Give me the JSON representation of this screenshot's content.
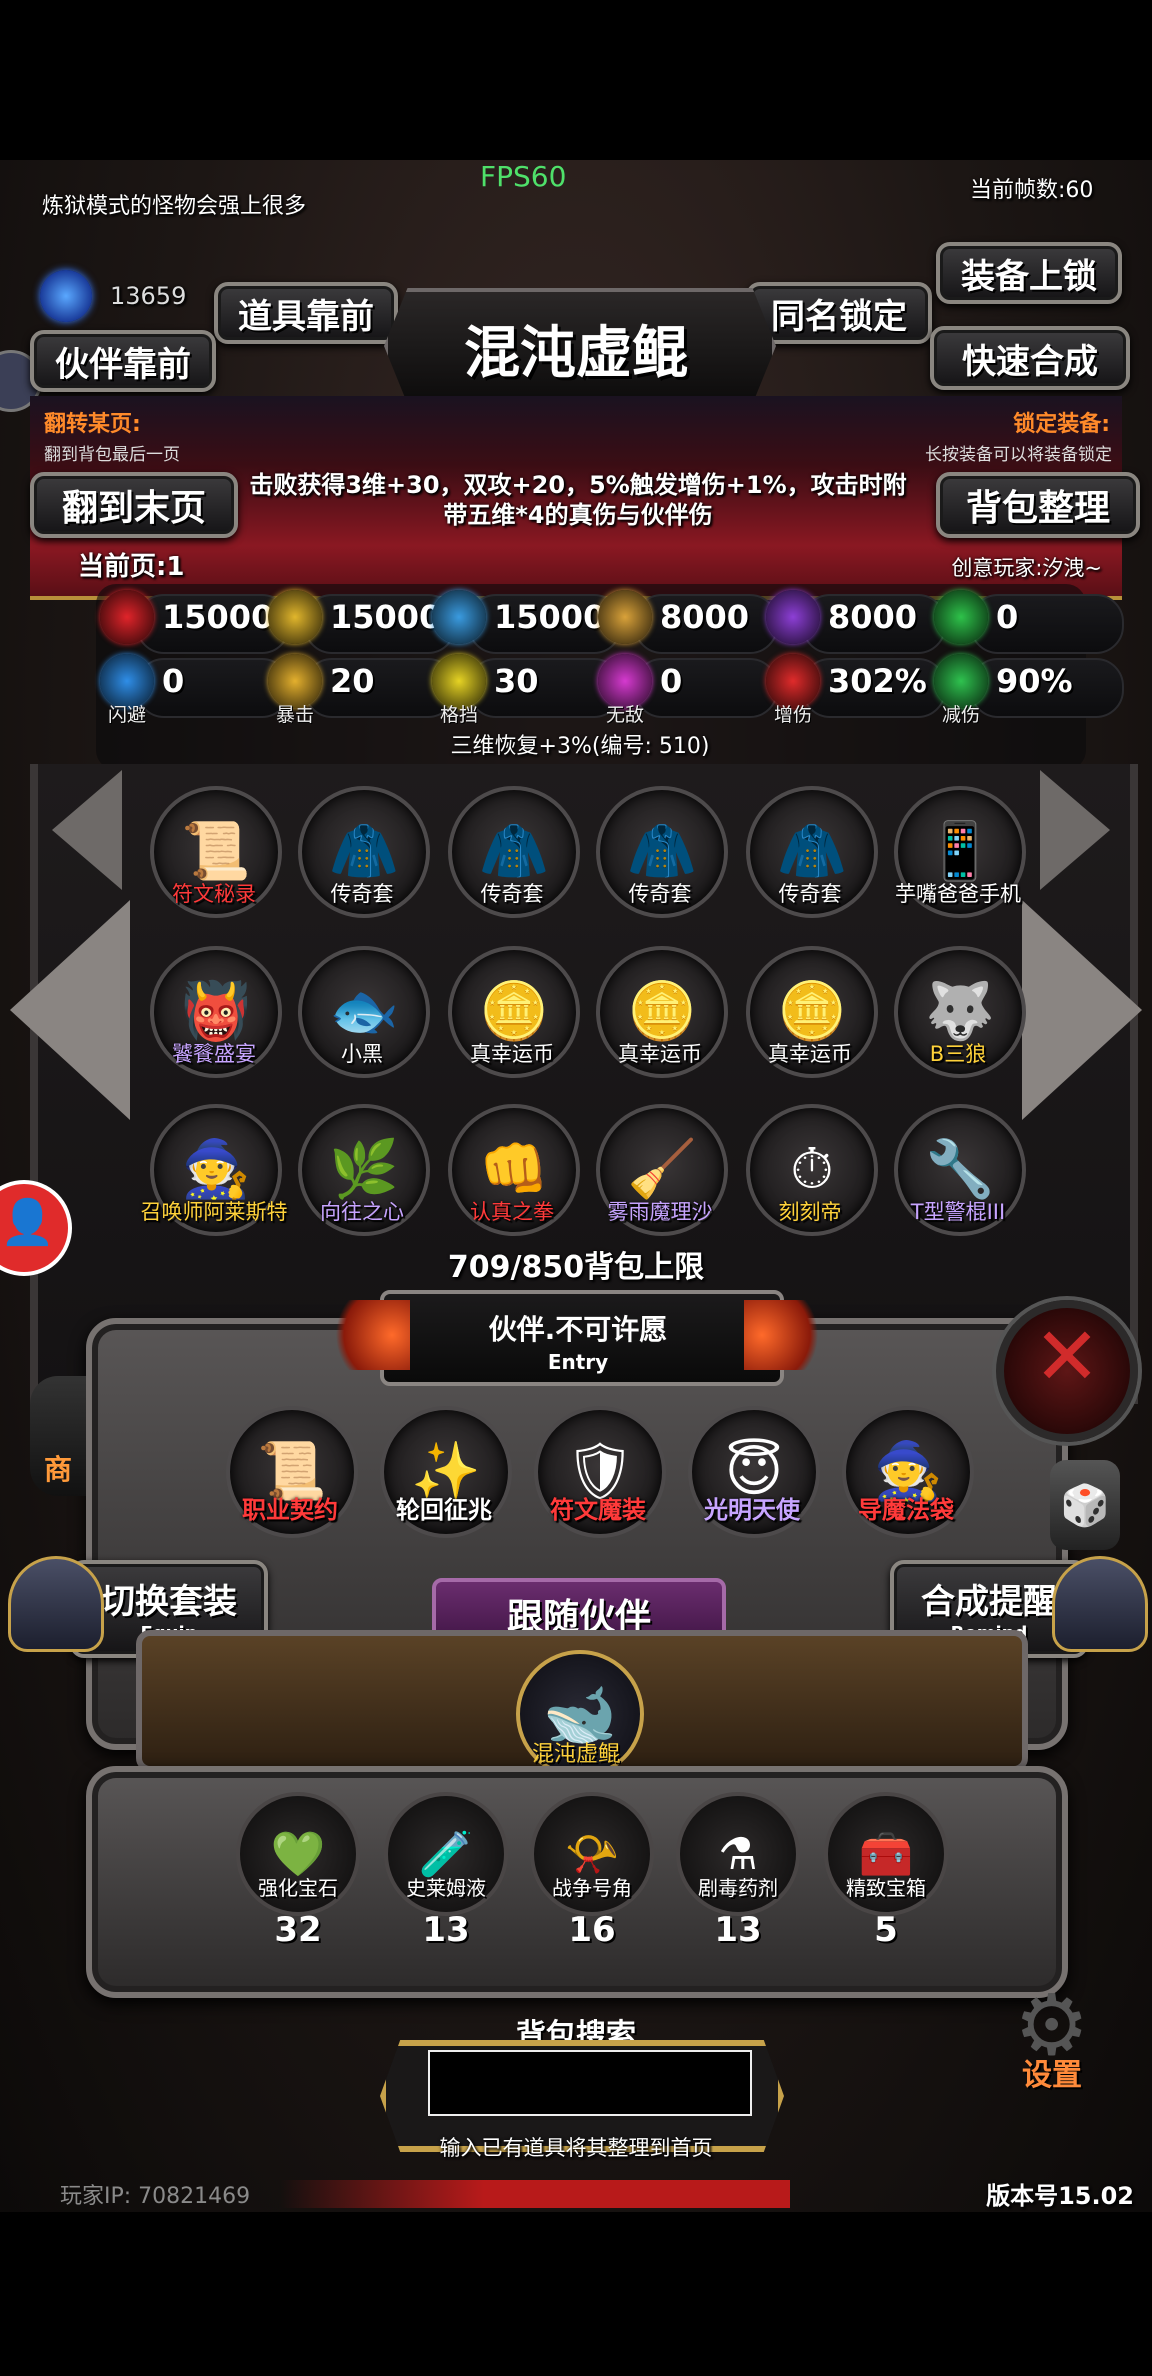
{
  "hud": {
    "fps": "FPS60",
    "hint": "炼狱模式的怪物会强上很多",
    "frame_counter": "当前帧数:60",
    "gems": "13659",
    "player_ip": "玩家IP:  70821469",
    "version": "版本号15.02"
  },
  "top_buttons": {
    "items_front": "道具靠前",
    "partner_front": "伙伴靠前",
    "same_name_lock": "同名锁定",
    "equip_lock": "装备上锁",
    "quick_synth": "快速合成",
    "jump_last": "翻到末页",
    "bag_sort": "背包整理"
  },
  "item_detail": {
    "title": "混沌虚鲲",
    "flip_title": "翻转某页:",
    "flip_sub": "翻到背包最后一页",
    "lock_title": "锁定装备:",
    "lock_sub": "长按装备可以将装备锁定",
    "description": "击败获得3维+30，双攻+20，5%触发增伤+1%，攻击时附带五维*4的真伤与伙伴伤",
    "current_page": "当前页:1",
    "creator": "创意玩家:汐洩~",
    "regen": "三维恢复+3%(编号: 510)"
  },
  "stats": [
    {
      "icon": "heart-icon",
      "value": "15000",
      "label": "",
      "color": "#e0242a"
    },
    {
      "icon": "strength-icon",
      "value": "15000",
      "label": "",
      "color": "#e1b62c"
    },
    {
      "icon": "mana-icon",
      "value": "15000",
      "label": "",
      "color": "#3a9be0"
    },
    {
      "icon": "sword-icon",
      "value": "8000",
      "label": "",
      "color": "#d9a23a"
    },
    {
      "icon": "magic-bolt-icon",
      "value": "8000",
      "label": "",
      "color": "#8d3fd6"
    },
    {
      "icon": "clover-icon",
      "value": "0",
      "label": "",
      "color": "#2ec24a"
    },
    {
      "icon": "dodge-icon",
      "value": "0",
      "label": "闪避",
      "color": "#2f8ee8"
    },
    {
      "icon": "crit-icon",
      "value": "20",
      "label": "暴击",
      "color": "#e4b02e"
    },
    {
      "icon": "block-icon",
      "value": "30",
      "label": "格挡",
      "color": "#e6d324"
    },
    {
      "icon": "invincible-icon",
      "value": "0",
      "label": "无敌",
      "color": "#d63ad0"
    },
    {
      "icon": "damage-up-icon",
      "value": "302%",
      "label": "增伤",
      "color": "#e02b2b"
    },
    {
      "icon": "damage-reduce-icon",
      "value": "90%",
      "label": "减伤",
      "color": "#2fc24f"
    }
  ],
  "inventory": [
    {
      "name": "符文秘录",
      "art": "📜",
      "color": "#ff3a3a"
    },
    {
      "name": "传奇套",
      "art": "🧥",
      "color": "#ffffff"
    },
    {
      "name": "传奇套",
      "art": "🧥",
      "color": "#ffffff"
    },
    {
      "name": "传奇套",
      "art": "🧥",
      "color": "#ffffff"
    },
    {
      "name": "传奇套",
      "art": "🧥",
      "color": "#ffffff"
    },
    {
      "name": "芋嘴爸爸手机",
      "art": "📱",
      "color": "#ffffff"
    },
    {
      "name": "饕餮盛宴",
      "art": "👹",
      "color": "#c7a4ff"
    },
    {
      "name": "小黑",
      "art": "🐟",
      "color": "#ffffff"
    },
    {
      "name": "真幸运币",
      "art": "🪙",
      "color": "#ffffff"
    },
    {
      "name": "真幸运币",
      "art": "🪙",
      "color": "#ffffff"
    },
    {
      "name": "真幸运币",
      "art": "🪙",
      "color": "#ffffff"
    },
    {
      "name": "B三狼",
      "art": "🐺",
      "color": "#ffd23a"
    },
    {
      "name": "召唤师阿莱斯特",
      "art": "🧙",
      "color": "#ffd23a"
    },
    {
      "name": "向往之心",
      "art": "🌿",
      "color": "#c7a4ff"
    },
    {
      "name": "认真之拳",
      "art": "👊",
      "color": "#ff3a3a"
    },
    {
      "name": "雾雨魔理沙",
      "art": "🧹",
      "color": "#c7a4ff"
    },
    {
      "name": "刻刻帝",
      "art": "⏱",
      "color": "#ffd23a"
    },
    {
      "name": "T型警棍III",
      "art": "🔧",
      "color": "#c7a4ff"
    }
  ],
  "bag_capacity": "709/850背包上限",
  "entry": {
    "title": "伙伴.不可许愿",
    "subtitle": "Entry"
  },
  "featured": [
    {
      "name": "职业契约",
      "art": "📜",
      "color": "#ff3a3a"
    },
    {
      "name": "轮回征兆",
      "art": "✨",
      "color": "#ffffff"
    },
    {
      "name": "符文魔装",
      "art": "🛡",
      "color": "#ff3a3a"
    },
    {
      "name": "光明天使",
      "art": "😇",
      "color": "#c7a4ff"
    },
    {
      "name": "导魔法袋",
      "art": "🧙",
      "color": "#ff3a3a"
    }
  ],
  "switch_equip": {
    "label": "切换套装",
    "sub": "Equip"
  },
  "synth_remind": {
    "label": "合成提醒",
    "sub": "Remind"
  },
  "follow_partner": {
    "title": "跟随伙伴",
    "name": "混沌虚鲲"
  },
  "materials": [
    {
      "name": "强化宝石",
      "count": "32",
      "art": "💚"
    },
    {
      "name": "史莱姆液",
      "count": "13",
      "art": "🧪"
    },
    {
      "name": "战争号角",
      "count": "16",
      "art": "📯"
    },
    {
      "name": "剧毒药剂",
      "count": "13",
      "art": "⚗"
    },
    {
      "name": "精致宝箱",
      "count": "5",
      "art": "🧰"
    }
  ],
  "search": {
    "title": "背包搜索",
    "placeholder": "",
    "hint": "输入已有道具将其整理到首页"
  },
  "side": {
    "shop": "商",
    "settings": "设置"
  }
}
